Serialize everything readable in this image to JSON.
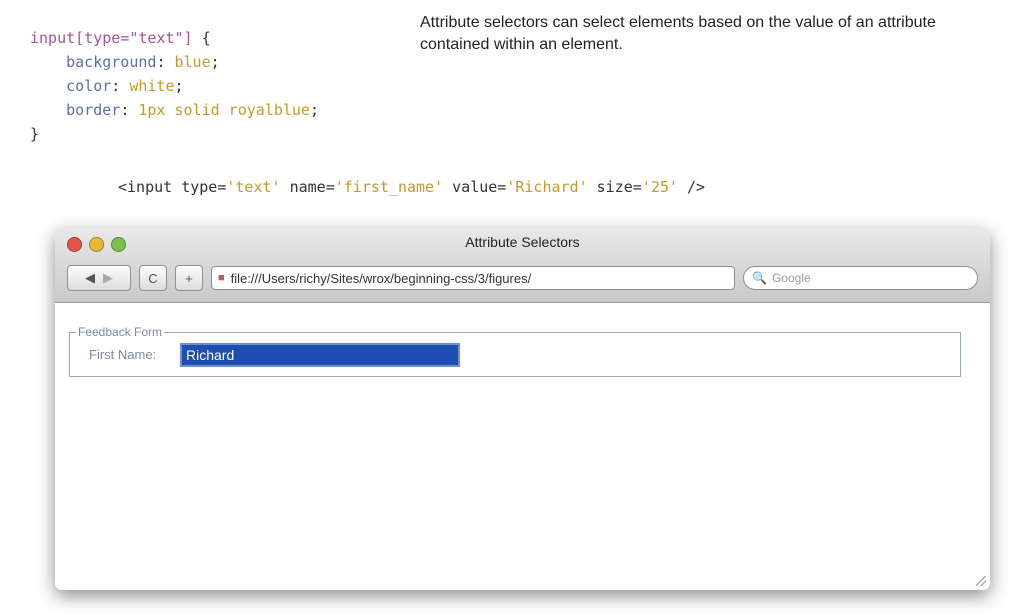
{
  "caption": "Attribute selectors can select elements based on the value of an attribute contained within an element.",
  "code": {
    "selector": "input[type=\"text\"]",
    "open_brace": " {",
    "lines": [
      {
        "prop": "background",
        "val": "blue"
      },
      {
        "prop": "color",
        "val": "white"
      },
      {
        "prop": "border",
        "val": "1px solid royalblue"
      }
    ],
    "close_brace": "}"
  },
  "html_line": {
    "tag_open": "<input ",
    "type_attr": "type=",
    "type_val": "'text'",
    "name_attr": " name=",
    "name_val": "'first_name'",
    "value_attr": " value=",
    "value_val": "'Richard'",
    "size_attr": " size=",
    "size_val": "'25'",
    "tag_close": " />"
  },
  "window": {
    "title": "Attribute Selectors",
    "address": "file:///Users/richy/Sites/wrox/beginning-css/3/figures/",
    "search_placeholder": "Google",
    "nav_back": "◀",
    "nav_forward": "▶",
    "reload": "C",
    "add": "+"
  },
  "form": {
    "legend": "Feedback Form",
    "label": "First Name:",
    "value": "Richard"
  },
  "colors": {
    "selected_input_bg": "#1e4fb0",
    "code_property": "#5b6fb0",
    "code_value": "#c59a2a"
  }
}
